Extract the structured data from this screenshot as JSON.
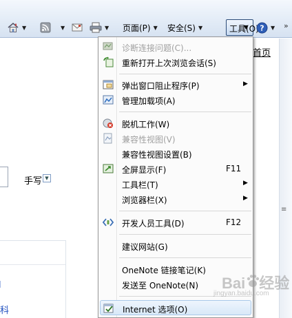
{
  "toolbar": {
    "page_label": "页面(P)",
    "safety_label": "安全(S)",
    "tools_label": "工具(O)"
  },
  "page": {
    "home_link": "首页",
    "handwrite_label": "手写",
    "left_link_partial": "科"
  },
  "menu": {
    "items": [
      {
        "label": "诊断连接问题(C)...",
        "disabled": true
      },
      {
        "label": "重新打开上次浏览会话(S)",
        "disabled": false
      },
      {
        "label": "弹出窗口阻止程序(P)",
        "submenu": true
      },
      {
        "label": "管理加载项(A)"
      },
      {
        "label": "脱机工作(W)"
      },
      {
        "label": "兼容性视图(V)",
        "disabled": true
      },
      {
        "label": "兼容性视图设置(B)"
      },
      {
        "label": "全屏显示(F)",
        "shortcut": "F11"
      },
      {
        "label": "工具栏(T)",
        "submenu": true
      },
      {
        "label": "浏览器栏(X)",
        "submenu": true
      },
      {
        "label": "开发人员工具(D)",
        "shortcut": "F12"
      },
      {
        "label": "建议网站(G)"
      },
      {
        "label": "OneNote 链接笔记(K)"
      },
      {
        "label": "发送至 OneNote(N)"
      },
      {
        "label": "Internet 选项(O)",
        "highlighted": true
      }
    ]
  },
  "watermark": {
    "brand": "Baidu",
    "suffix": "经验",
    "url": "jingyan.baidu.com"
  },
  "colors": {
    "link_blue": "#1f4fbf",
    "menu_border": "#979797",
    "highlight": "#d8e8f8"
  }
}
